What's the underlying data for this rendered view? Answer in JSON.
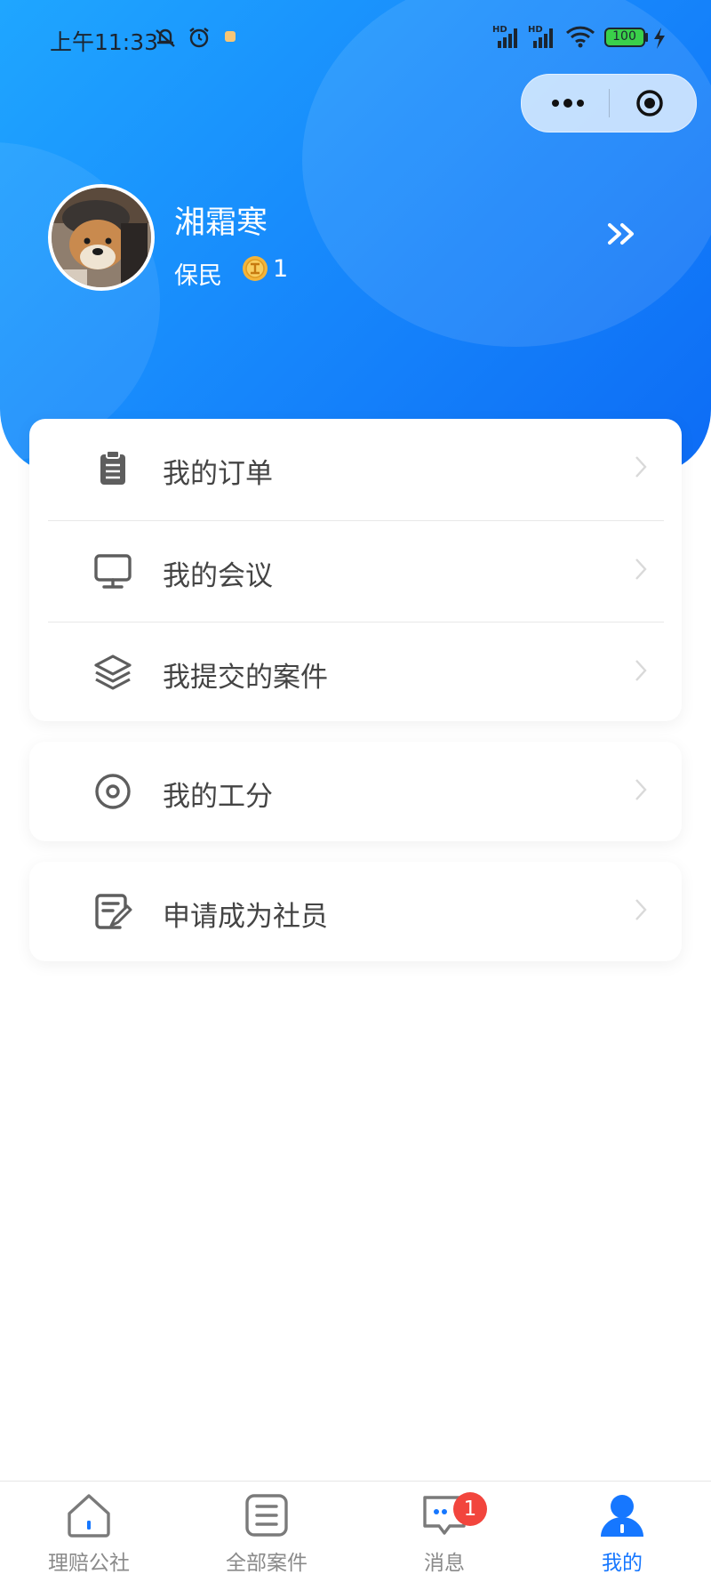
{
  "status_bar": {
    "time": "上午11:33",
    "battery": "100",
    "icons": [
      "mute-bell-icon",
      "alarm-icon",
      "notification-dot-icon",
      "hd-signal-icon",
      "hd-signal-icon",
      "wifi-icon",
      "battery-icon",
      "charging-icon"
    ]
  },
  "capsule": {
    "more_icon": "more-dots-icon",
    "close_icon": "target-close-icon"
  },
  "profile": {
    "username": "湘霜寒",
    "role": "保民",
    "coin_icon": "coin-icon",
    "coin_count": "1",
    "arrow_icon": "double-chevron-right-icon"
  },
  "menu_groups": [
    {
      "items": [
        {
          "label": "我的订单",
          "icon": "clipboard-icon"
        },
        {
          "label": "我的会议",
          "icon": "monitor-icon"
        },
        {
          "label": "我提交的案件",
          "icon": "layers-icon"
        }
      ]
    },
    {
      "items": [
        {
          "label": "我的工分",
          "icon": "target-icon"
        }
      ]
    },
    {
      "items": [
        {
          "label": "申请成为社员",
          "icon": "edit-document-icon"
        }
      ]
    }
  ],
  "tabbar": {
    "tabs": [
      {
        "label": "理赔公社",
        "icon": "home-icon",
        "active": false
      },
      {
        "label": "全部案件",
        "icon": "list-icon",
        "active": false
      },
      {
        "label": "消息",
        "icon": "chat-icon",
        "active": false,
        "badge": "1"
      },
      {
        "label": "我的",
        "icon": "user-icon",
        "active": true
      }
    ]
  },
  "colors": {
    "brand_blue": "#1677ff",
    "badge_red": "#f2453d",
    "text_gray": "#444444"
  }
}
